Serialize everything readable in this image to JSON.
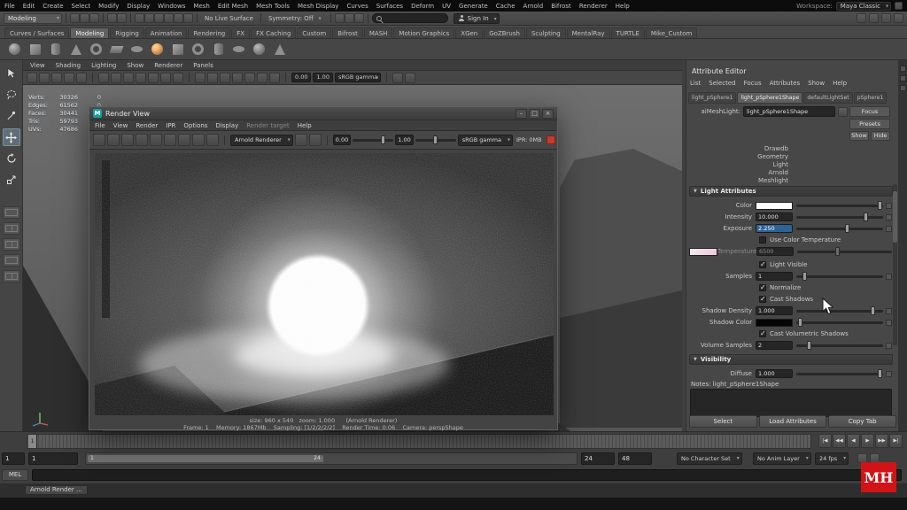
{
  "icons": {
    "maya_logo": "M",
    "minimize": "–",
    "maximize": "□",
    "close": "×"
  },
  "menubar": {
    "items": [
      "File",
      "Edit",
      "Create",
      "Select",
      "Modify",
      "Display",
      "Windows",
      "Mesh",
      "Edit Mesh",
      "Mesh Tools",
      "Mesh Display",
      "Curves",
      "Surfaces",
      "Deform",
      "UV",
      "Generate",
      "Cache",
      "Arnold",
      "Bifrost",
      "Renderer",
      "Help"
    ],
    "workspace_label": "Workspace:",
    "workspace_value": "Maya Classic"
  },
  "statusline": {
    "mode": "Modeling",
    "no_live_surface": "No Live Surface",
    "symmetry": "Symmetry: Off",
    "sign_in": "Sign In"
  },
  "shelf": {
    "tabs": [
      "Curves / Surfaces",
      "Modeling",
      "Rigging",
      "Animation",
      "Rendering",
      "FX",
      "FX Caching",
      "Custom",
      "Bifrost",
      "MASH",
      "Motion Graphics",
      "XGen",
      "GoZBrush",
      "Sculpting",
      "MentalRay",
      "TURTLE",
      "Mike_Custom"
    ],
    "active_index": 1
  },
  "viewport": {
    "panel_menus": [
      "View",
      "Shading",
      "Lighting",
      "Show",
      "Renderer",
      "Panels"
    ],
    "exposure": "0.00",
    "gamma": "1.00",
    "view_transform": "sRGB gamma",
    "hud": [
      {
        "label": "Verts:",
        "value": "30326",
        "sel": "0"
      },
      {
        "label": "Edges:",
        "value": "61562",
        "sel": "0"
      },
      {
        "label": "Faces:",
        "value": "30441",
        "sel": "0"
      },
      {
        "label": "Tris:",
        "value": "59793",
        "sel": "0"
      },
      {
        "label": "UVs:",
        "value": "47686",
        "sel": "0"
      }
    ]
  },
  "render_view": {
    "title": "Render View",
    "menus": [
      "File",
      "View",
      "Render",
      "IPR",
      "Options",
      "Display"
    ],
    "menu_muted": "Render target",
    "menu_help": "Help",
    "renderer": "Arnold Renderer",
    "exposure": "0.00",
    "gamma": "1.00",
    "view_transform": "sRGB gamma",
    "ipr_status": "IPR: 0MB",
    "status_line1": "size: 960 x 540   zoom: 1.000      (Arnold Renderer)",
    "status_line2": "Frame: 1    Memory: 1867Mb    Sampling: [1/2/2/2/2]    Render Time: 0:06    Camera: perspShape"
  },
  "attribute_editor": {
    "title": "Attribute Editor",
    "menus": [
      "List",
      "Selected",
      "Focus",
      "Attributes",
      "Show",
      "Help"
    ],
    "tabs": [
      "light_pSphere1",
      "light_pSphere1Shape",
      "defaultLightSet",
      "pSphere1"
    ],
    "active_tab_index": 1,
    "node_label": "aiMeshLight:",
    "node_name": "light_pSphere1Shape",
    "focus_button": "Focus",
    "presets_button": "Presets",
    "show_button": "Show",
    "hide_button": "Hide",
    "classification": [
      "Drawdb",
      "Geometry",
      "Light",
      "Arnold",
      "Meshlight"
    ],
    "light_attributes": {
      "header": "Light Attributes",
      "color_label": "Color",
      "intensity_label": "Intensity",
      "intensity_value": "10.000",
      "exposure_label": "Exposure",
      "exposure_value": "2.250",
      "use_color_temperature_label": "Use Color Temperature",
      "temperature_label": "Temperature",
      "temperature_value": "6500",
      "light_visible_label": "Light Visible",
      "samples_label": "Samples",
      "samples_value": "1",
      "normalize_label": "Normalize",
      "cast_shadows_label": "Cast Shadows",
      "shadow_density_label": "Shadow Density",
      "shadow_density_value": "1.000",
      "shadow_color_label": "Shadow Color",
      "cast_volumetric_label": "Cast Volumetric Shadows",
      "volume_samples_label": "Volume Samples",
      "volume_samples_value": "2"
    },
    "visibility": {
      "header": "Visibility",
      "diffuse_label": "Diffuse",
      "diffuse_value": "1.000"
    },
    "notes_label": "Notes: light_pSphere1Shape",
    "select_button": "Select",
    "load_attributes_button": "Load Attributes",
    "copy_tab_button": "Copy Tab"
  },
  "timeline": {
    "current_frame": "1",
    "anim_start": "1",
    "playback_start": "1",
    "range_start_label": "1",
    "range_end_label": "24",
    "playback_end": "24",
    "anim_end": "48",
    "character_set": "No Character Set",
    "anim_layer": "No Anim Layer",
    "fps": "24 fps",
    "playback_icons": [
      "|◀",
      "◀◀",
      "◀",
      "▶",
      "▶▶",
      "▶|"
    ]
  },
  "command_line": {
    "mode": "MEL",
    "help_text": "Arnold Render ..."
  },
  "watermark": "MH"
}
